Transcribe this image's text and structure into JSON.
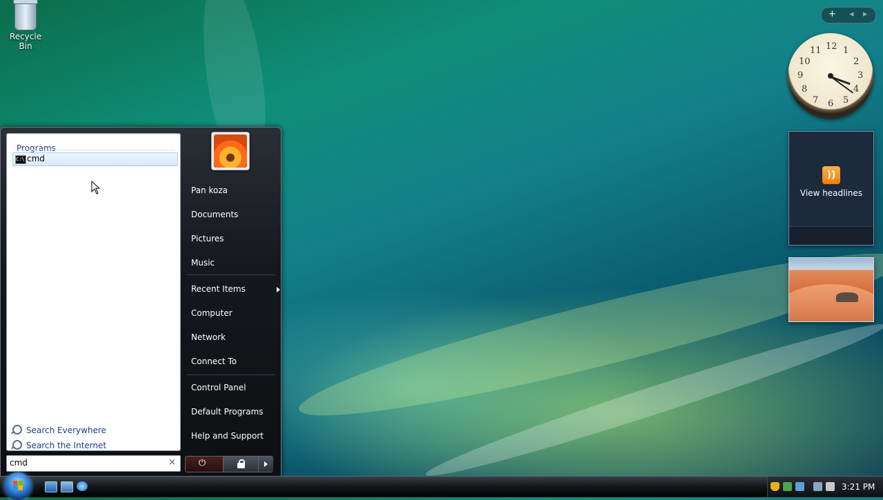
{
  "desktop": {
    "recycle_bin_label": "Recycle Bin"
  },
  "sidebar": {
    "add_gadget": "+",
    "prev": "◂",
    "next": "▸",
    "clock_numbers": [
      "12",
      "1",
      "2",
      "3",
      "4",
      "5",
      "6",
      "7",
      "8",
      "9",
      "10",
      "11"
    ],
    "clock_time": "3:21",
    "feed_label": "View headlines"
  },
  "start_menu": {
    "programs_header": "Programs",
    "results": [
      {
        "label": "cmd",
        "icon": "cmd-icon"
      }
    ],
    "search_everywhere": "Search Everywhere",
    "search_internet": "Search the Internet",
    "search_value": "cmd",
    "search_clear": "×",
    "right_items": {
      "user": "Pan koza",
      "documents": "Documents",
      "pictures": "Pictures",
      "music": "Music",
      "recent": "Recent Items",
      "computer": "Computer",
      "network": "Network",
      "connect": "Connect To",
      "control_panel": "Control Panel",
      "default_programs": "Default Programs",
      "help": "Help and Support"
    },
    "power_glyph": "⏻"
  },
  "taskbar": {
    "time": "3:21 PM"
  }
}
